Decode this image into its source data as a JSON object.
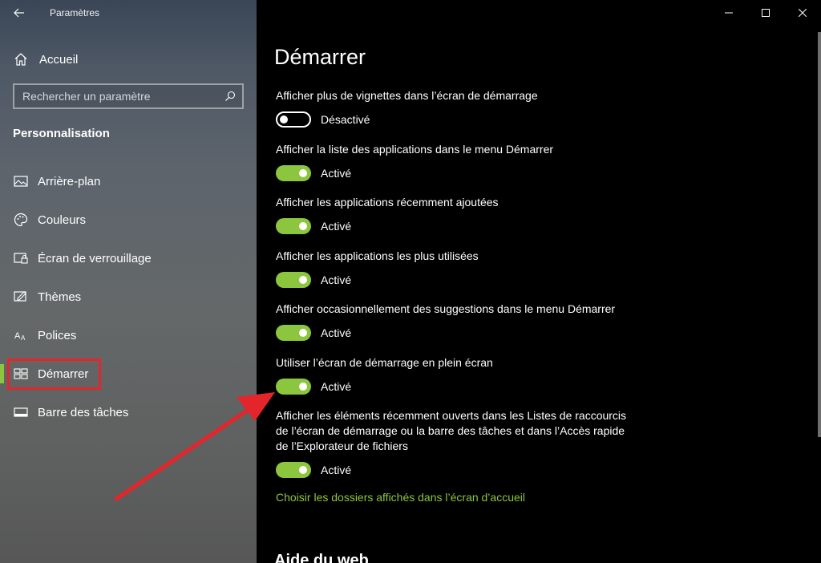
{
  "window": {
    "title": "Paramètres"
  },
  "sidebar": {
    "home_label": "Accueil",
    "search_placeholder": "Rechercher un paramètre",
    "section_title": "Personnalisation",
    "items": [
      {
        "label": "Arrière-plan",
        "icon": "picture-icon"
      },
      {
        "label": "Couleurs",
        "icon": "palette-icon"
      },
      {
        "label": "Écran de verrouillage",
        "icon": "lock-screen-icon"
      },
      {
        "label": "Thèmes",
        "icon": "themes-icon"
      },
      {
        "label": "Polices",
        "icon": "fonts-icon"
      },
      {
        "label": "Démarrer",
        "icon": "start-icon",
        "active": true
      },
      {
        "label": "Barre des tâches",
        "icon": "taskbar-icon"
      }
    ]
  },
  "main": {
    "title": "Démarrer",
    "settings": [
      {
        "label": "Afficher plus de vignettes dans l’écran de démarrage",
        "state": "Désactivé",
        "on": false
      },
      {
        "label": "Afficher la liste des applications dans le menu Démarrer",
        "state": "Activé",
        "on": true
      },
      {
        "label": "Afficher les applications récemment ajoutées",
        "state": "Activé",
        "on": true
      },
      {
        "label": "Afficher les applications les plus utilisées",
        "state": "Activé",
        "on": true
      },
      {
        "label": "Afficher occasionnellement des suggestions dans le menu Démarrer",
        "state": "Activé",
        "on": true
      },
      {
        "label": "Utiliser l’écran de démarrage en plein écran",
        "state": "Activé",
        "on": true
      },
      {
        "label": "Afficher les éléments récemment ouverts dans les Listes de raccourcis de l’écran de démarrage ou la barre des tâches et dans l’Accès rapide de l’Explorateur de fichiers",
        "state": "Activé",
        "on": true
      }
    ],
    "link": "Choisir les dossiers affichés dans l’écran d’accueil",
    "web_help_title": "Aide du web"
  },
  "colors": {
    "accent": "#8cc63f",
    "highlight": "#e4252b"
  }
}
